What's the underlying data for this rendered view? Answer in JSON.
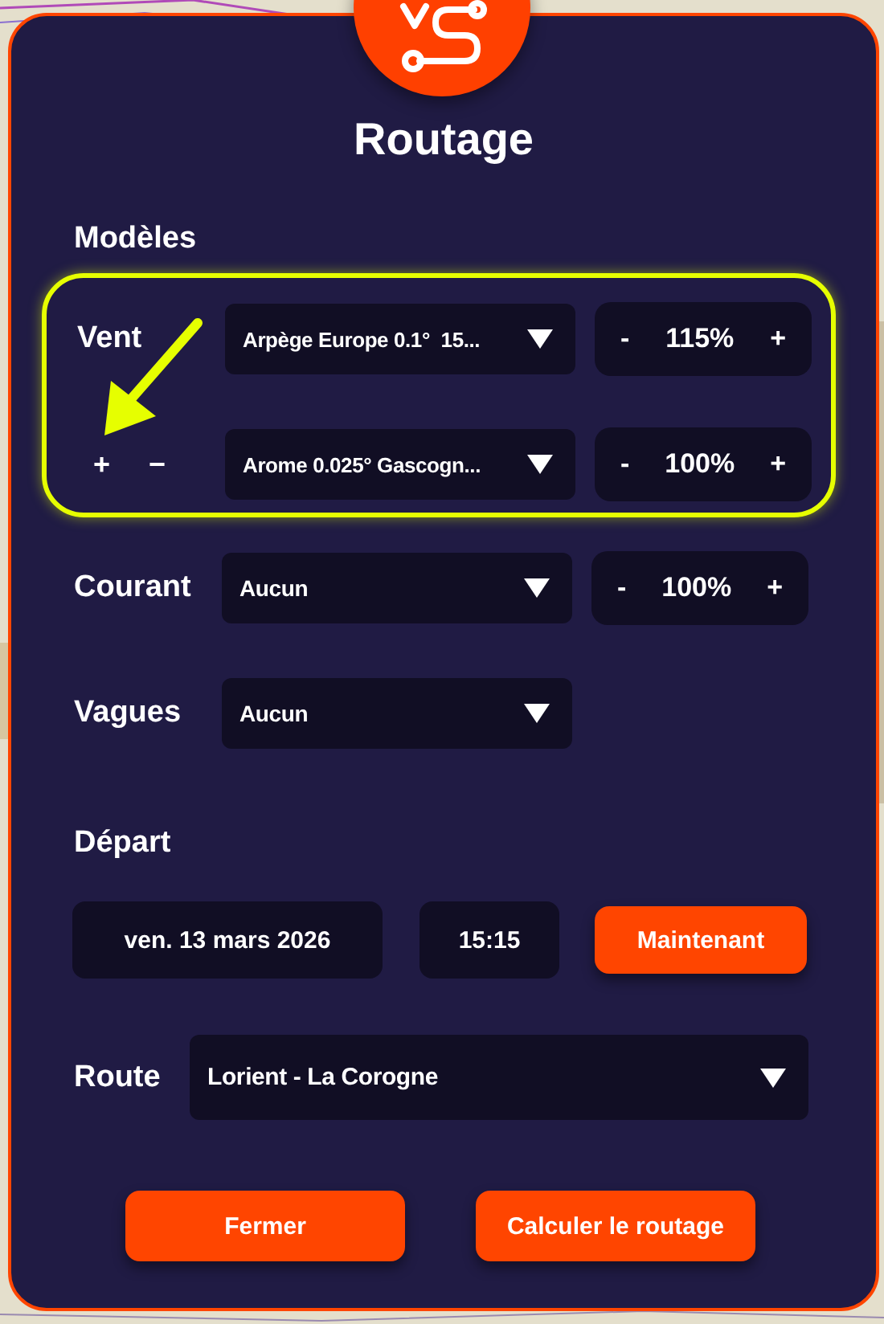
{
  "header": {
    "title": "Routage"
  },
  "models": {
    "heading": "Modèles",
    "wind": {
      "label": "Vent",
      "add": "+",
      "remove": "−",
      "highlighted": true,
      "rows": [
        {
          "model": "Arpège Europe 0.1°  15...",
          "decrease": "-",
          "factor": "115%",
          "increase": "+"
        },
        {
          "model": "Arome 0.025° Gascogn...",
          "decrease": "-",
          "factor": "100%",
          "increase": "+"
        }
      ]
    },
    "current": {
      "label": "Courant",
      "model": "Aucun",
      "decrease": "-",
      "factor": "100%",
      "increase": "+"
    },
    "waves": {
      "label": "Vagues",
      "model": "Aucun"
    }
  },
  "departure": {
    "heading": "Départ",
    "date": "ven. 13 mars 2026",
    "time": "15:15",
    "now_button": "Maintenant"
  },
  "route": {
    "label": "Route",
    "value": "Lorient - La Corogne"
  },
  "buttons": [
    "Fermer",
    "Calculer le routage"
  ]
}
